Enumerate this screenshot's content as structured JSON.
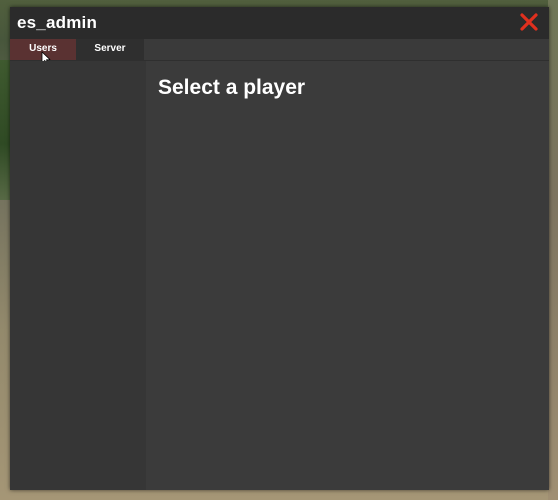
{
  "window": {
    "title": "es_admin"
  },
  "tabs": [
    {
      "label": "Users",
      "active": true
    },
    {
      "label": "Server",
      "active": false
    }
  ],
  "main": {
    "heading": "Select a player"
  },
  "colors": {
    "close_icon": "#e0301e",
    "active_tab": "#5a3232",
    "panel": "#3b3b3b",
    "titlebar": "#2b2b2b"
  },
  "icons": {
    "close": "close-icon",
    "cursor": "mouse-cursor-icon"
  }
}
